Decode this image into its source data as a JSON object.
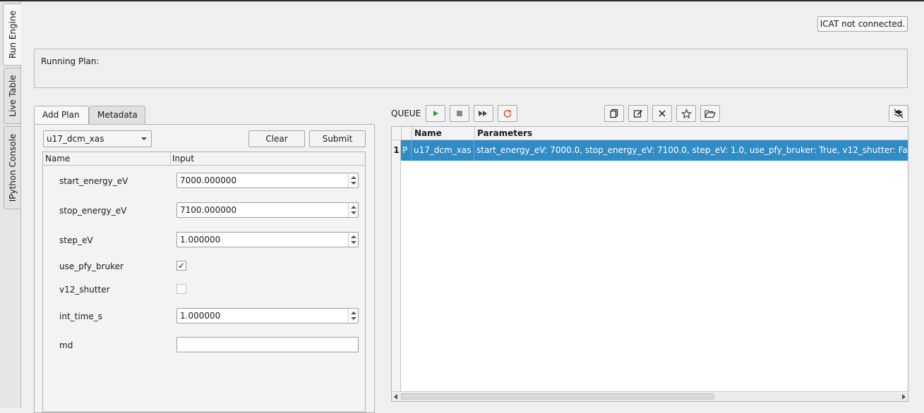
{
  "side_tabs": [
    "Run Engine",
    "Live Table",
    "IPython Console"
  ],
  "icat_status": "ICAT not connected.",
  "running_plan_label": "Running Plan:",
  "plan_tabs": [
    "Add Plan",
    "Metadata"
  ],
  "plan_selector": "u17_dcm_xas",
  "buttons": {
    "clear": "Clear",
    "submit": "Submit"
  },
  "param_headers": {
    "name": "Name",
    "input": "Input"
  },
  "params": [
    {
      "name": "start_energy_eV",
      "value": "7000.000000"
    },
    {
      "name": "stop_energy_eV",
      "value": "7100.000000"
    },
    {
      "name": "step_eV",
      "value": "1.000000"
    },
    {
      "name": "use_pfy_bruker",
      "checked": true
    },
    {
      "name": "v12_shutter",
      "checked": false
    },
    {
      "name": "int_time_s",
      "value": "1.000000"
    },
    {
      "name": "md",
      "value": ""
    }
  ],
  "queue": {
    "label": "QUEUE",
    "headers": {
      "name": "Name",
      "parameters": "Parameters"
    },
    "rows": [
      {
        "num": "1",
        "flag": "P",
        "name": "u17_dcm_xas",
        "parameters": "start_energy_eV: 7000.0, stop_energy_eV: 7100.0, step_eV: 1.0, use_pfy_bruker: True, v12_shutter: Fa"
      }
    ]
  },
  "colors": {
    "selection": "#308cc6",
    "play": "#2e9d2e",
    "refresh": "#d6542b"
  }
}
